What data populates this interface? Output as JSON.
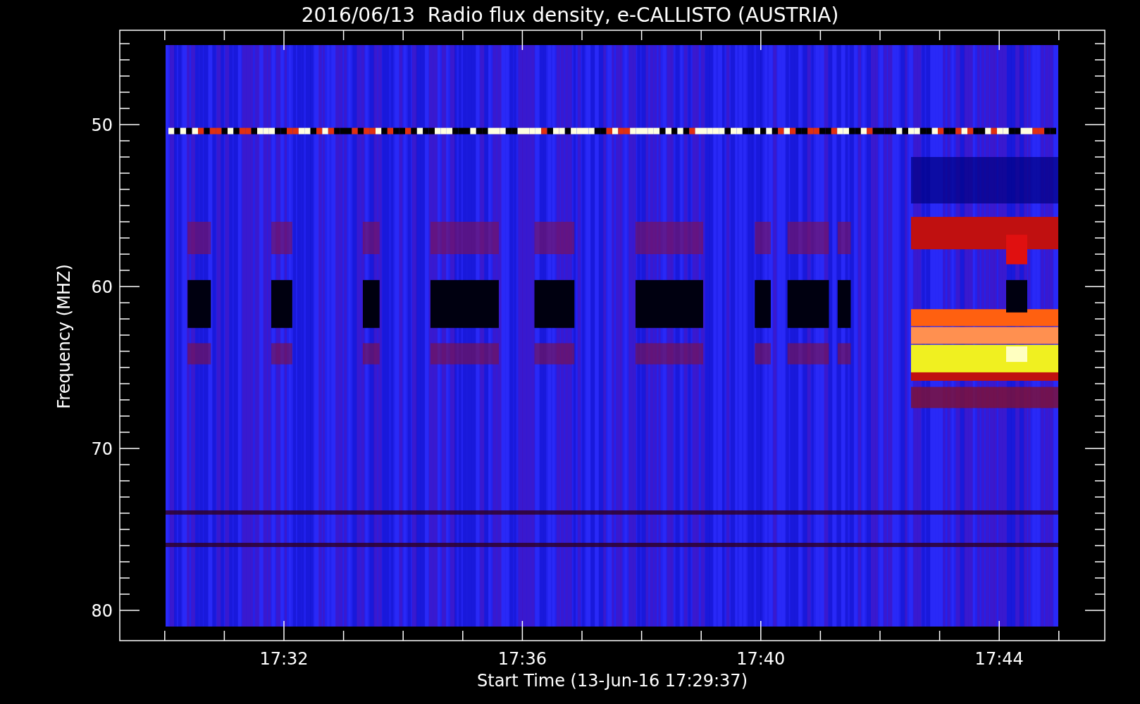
{
  "title": "2016/06/13  Radio flux density, e-CALLISTO (AUSTRIA)",
  "x_axis": {
    "label": "Start Time (13-Jun-16 17:29:37)",
    "ticks": [
      "17:32",
      "17:36",
      "17:40",
      "17:44"
    ]
  },
  "y_axis": {
    "label": "Frequency (MHZ)",
    "ticks": [
      "50",
      "60",
      "70",
      "80"
    ]
  }
}
